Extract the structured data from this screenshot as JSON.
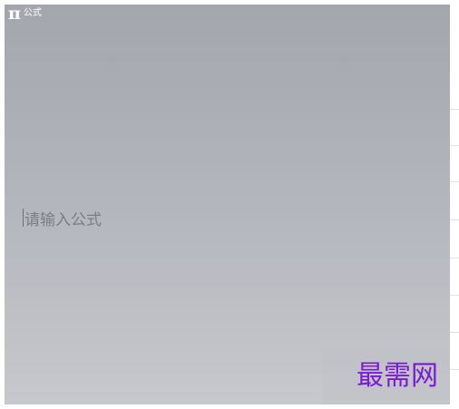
{
  "panel": {
    "title": "公式",
    "icon": "pi-icon",
    "icon_glyph": "π"
  },
  "formula_input": {
    "placeholder": "请输入公式",
    "value": ""
  },
  "watermark": {
    "text": "最需网",
    "color": "#7a1ad6"
  },
  "colors": {
    "panel_top": "#a4a6ae",
    "panel_bottom": "#c7c8cd",
    "placeholder_text": "#7b7d85"
  }
}
